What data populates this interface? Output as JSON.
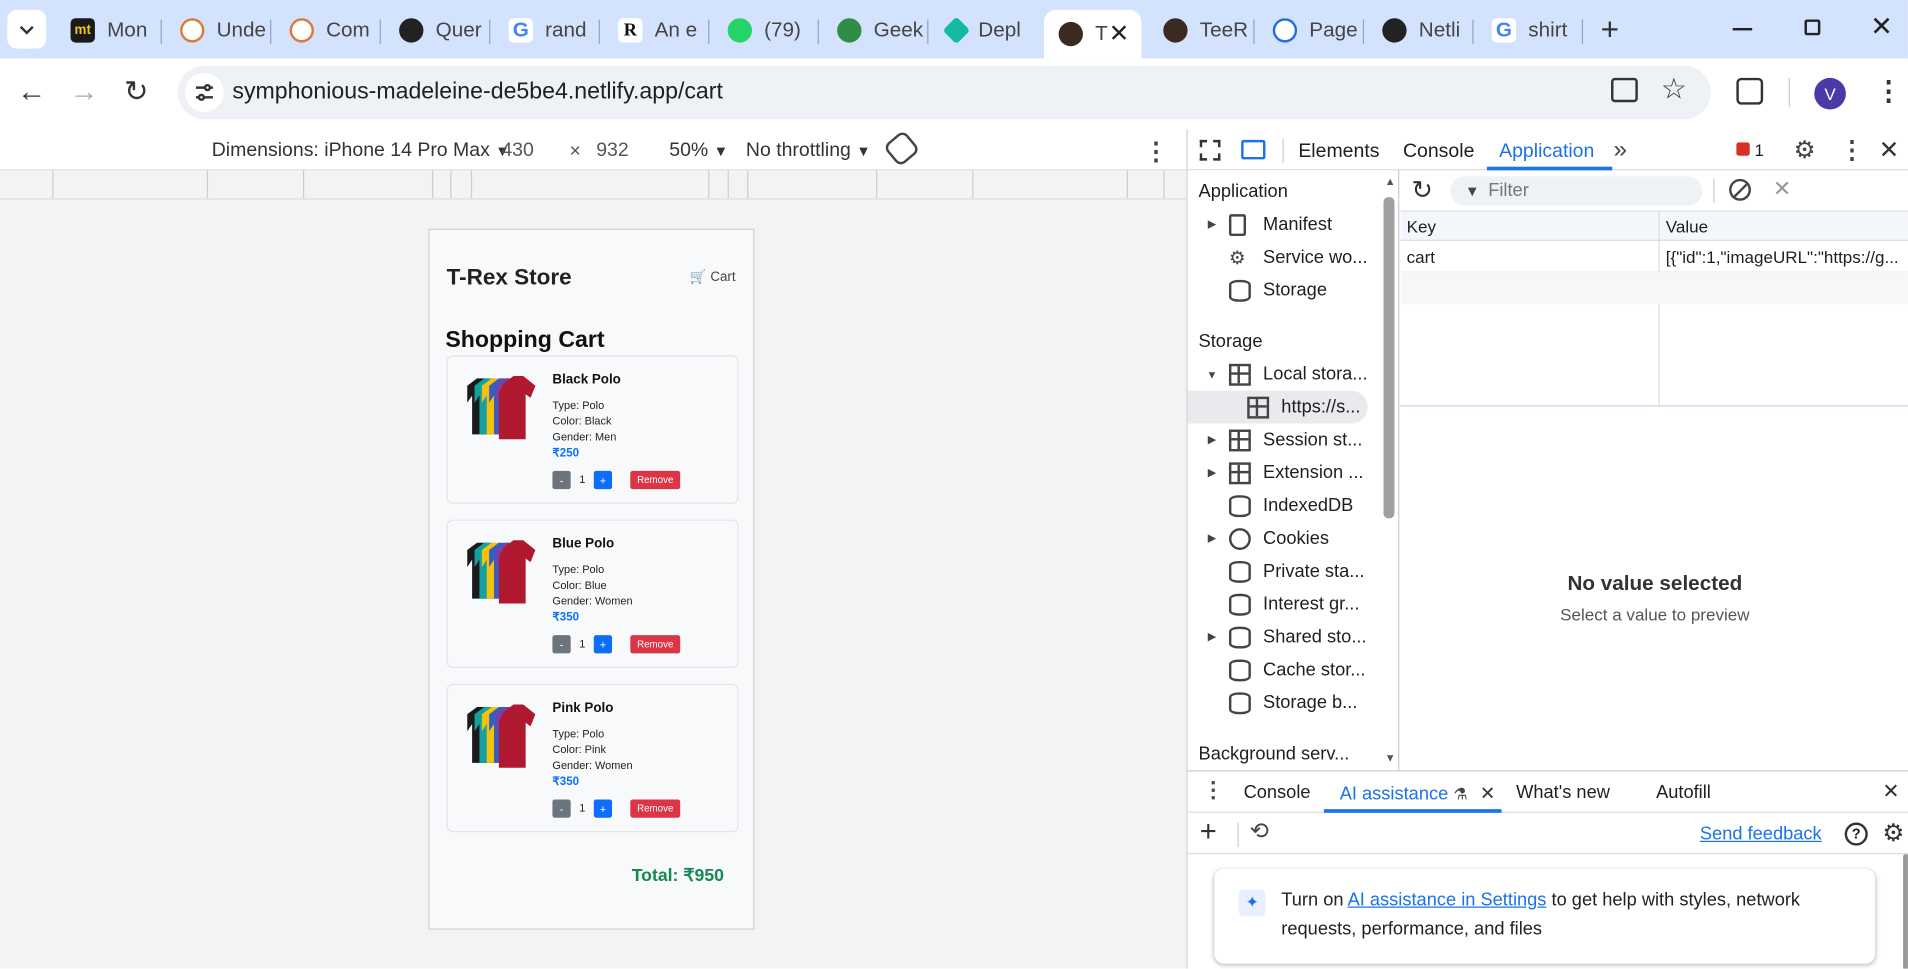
{
  "browser": {
    "tabs": [
      {
        "label": "Mon",
        "icon": "mt-icon"
      },
      {
        "label": "Unde",
        "icon": "gov-emblem-icon"
      },
      {
        "label": "Com",
        "icon": "gov-emblem-icon"
      },
      {
        "label": "Quer",
        "icon": "openai-icon"
      },
      {
        "label": "rand",
        "icon": "google-icon"
      },
      {
        "label": "An e",
        "icon": "researchgate-icon"
      },
      {
        "label": "(79) ",
        "icon": "whatsapp-icon"
      },
      {
        "label": "Geek",
        "icon": "geeksforgeeks-icon"
      },
      {
        "label": "Depl",
        "icon": "netlify-icon"
      },
      {
        "label": "T",
        "icon": "tshirt-icon",
        "active": true
      },
      {
        "label": "TeeR",
        "icon": "tshirt-icon"
      },
      {
        "label": "Page",
        "icon": "react-icon"
      },
      {
        "label": "Netli",
        "icon": "openai-icon"
      },
      {
        "label": "shirt",
        "icon": "google-icon"
      }
    ],
    "url": "symphonious-madeleine-de5be4.netlify.app/cart",
    "profile_initial": "V"
  },
  "device_toolbar": {
    "dimensions_label": "Dimensions: iPhone 14 Pro Max",
    "width": "430",
    "times": "×",
    "height": "932",
    "zoom": "50%",
    "throttling": "No throttling"
  },
  "store": {
    "brand": "T-Rex Store",
    "cart_link": "Cart",
    "heading": "Shopping Cart",
    "remove_label": "Remove",
    "minus_label": "-",
    "plus_label": "+",
    "items": [
      {
        "name": "Black Polo",
        "type": "Type: Polo",
        "color": "Color: Black",
        "gender": "Gender: Men",
        "price": "₹250",
        "qty": "1"
      },
      {
        "name": "Blue Polo",
        "type": "Type: Polo",
        "color": "Color: Blue",
        "gender": "Gender: Women",
        "price": "₹350",
        "qty": "1"
      },
      {
        "name": "Pink Polo",
        "type": "Type: Polo",
        "color": "Color: Pink",
        "gender": "Gender: Women",
        "price": "₹350",
        "qty": "1"
      }
    ],
    "total": "Total: ₹950"
  },
  "devtools": {
    "tabs": [
      "Elements",
      "Console",
      "Application"
    ],
    "active_tab": "Application",
    "error_count": "1",
    "filter_placeholder": "Filter",
    "tree": {
      "application_header": "Application",
      "manifest": "Manifest",
      "service_workers": "Service wo...",
      "storage_item": "Storage",
      "storage_header": "Storage",
      "local_storage": "Local stora...",
      "local_origin": "https://s...",
      "session_storage": "Session st...",
      "extension": "Extension ...",
      "indexeddb": "IndexedDB",
      "cookies": "Cookies",
      "private_state": "Private sta...",
      "interest_groups": "Interest gr...",
      "shared_storage": "Shared sto...",
      "cache_storage": "Cache stor...",
      "storage_buckets": "Storage b...",
      "background_services": "Background serv..."
    },
    "table": {
      "key_header": "Key",
      "value_header": "Value",
      "rows": [
        {
          "key": "cart",
          "value": "[{\"id\":1,\"imageURL\":\"https://g..."
        }
      ]
    },
    "preview_title": "No value selected",
    "preview_sub": "Select a value to preview",
    "drawer": {
      "tabs": [
        "Console",
        "AI assistance",
        "What's new",
        "Autofill"
      ],
      "active_tab": "AI assistance",
      "send_feedback": "Send feedback",
      "notice_prefix": "Turn on ",
      "notice_link": "AI assistance in Settings",
      "notice_suffix": " to get help with styles, network",
      "notice_line2": "requests, performance, and files"
    }
  }
}
